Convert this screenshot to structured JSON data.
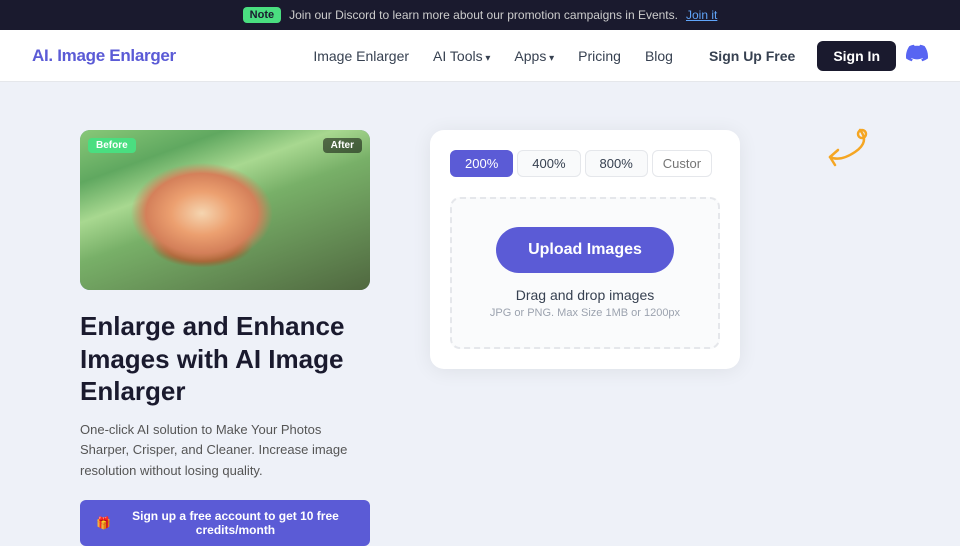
{
  "notification": {
    "badge": "Note",
    "text": "Join our Discord to learn more about our promotion campaigns in Events.",
    "link_text": "Join it"
  },
  "header": {
    "logo": "AI. Image Enlarger",
    "nav": [
      {
        "label": "Image Enlarger",
        "has_arrow": false
      },
      {
        "label": "AI Tools",
        "has_arrow": true
      },
      {
        "label": "Apps",
        "has_arrow": true
      },
      {
        "label": "Pricing",
        "has_arrow": false
      },
      {
        "label": "Blog",
        "has_arrow": false
      }
    ],
    "btn_signup": "Sign Up Free",
    "btn_signin": "Sign In"
  },
  "hero": {
    "before_label": "Before",
    "after_label": "After",
    "title": "Enlarge and Enhance Images with AI Image Enlarger",
    "description": "One-click AI solution to Make Your Photos Sharper, Crisper, and Cleaner. Increase image resolution without losing quality.",
    "cta_button": "Sign up a free account to get 10 free credits/month"
  },
  "upload_widget": {
    "zoom_options": [
      {
        "label": "200%",
        "active": true
      },
      {
        "label": "400%",
        "active": false
      },
      {
        "label": "800%",
        "active": false
      }
    ],
    "zoom_input_placeholder": "Custom",
    "upload_button": "Upload Images",
    "drag_text": "Drag and drop images",
    "hint_text": "JPG or PNG. Max Size 1MB or 1200px"
  }
}
